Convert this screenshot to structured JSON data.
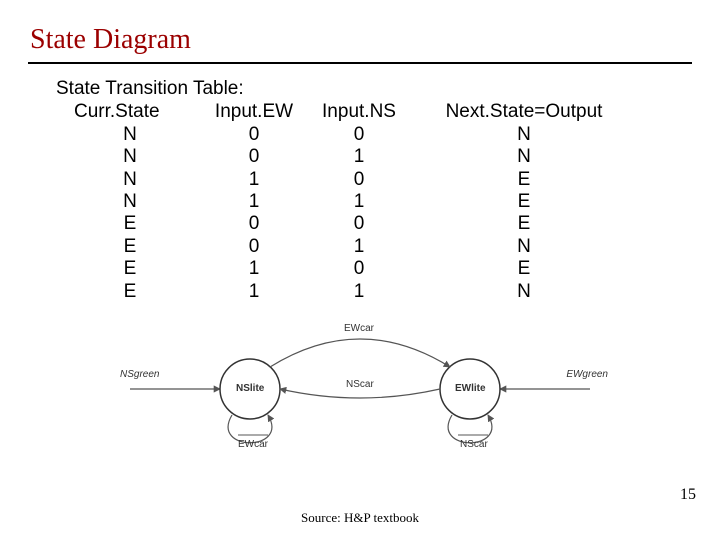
{
  "title": "State Diagram",
  "table": {
    "caption": "State Transition Table:",
    "headers": [
      "Curr.State",
      "Input.EW",
      "Input.NS",
      "Next.State=Output"
    ],
    "rows": [
      [
        "N",
        "0",
        "0",
        "N"
      ],
      [
        "N",
        "0",
        "1",
        "N"
      ],
      [
        "N",
        "1",
        "0",
        "E"
      ],
      [
        "N",
        "1",
        "1",
        "E"
      ],
      [
        "E",
        "0",
        "0",
        "E"
      ],
      [
        "E",
        "0",
        "1",
        "N"
      ],
      [
        "E",
        "1",
        "0",
        "E"
      ],
      [
        "E",
        "1",
        "1",
        "N"
      ]
    ]
  },
  "diagram": {
    "outer_left": "NSgreen",
    "outer_right": "EWgreen",
    "node_left": "NSlite",
    "node_right": "EWlite",
    "edge_top": "EWcar",
    "edge_mid": "NScar",
    "edge_bottom_left": "EWcar",
    "edge_bottom_right": "NScar"
  },
  "page_number": "15",
  "source": "Source: H&P textbook"
}
